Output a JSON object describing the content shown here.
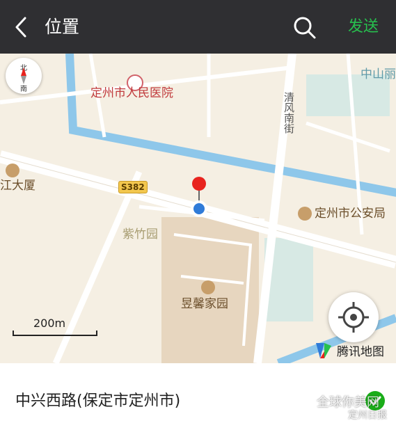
{
  "topbar": {
    "back_icon": "chevron-left-icon",
    "title": "位置",
    "search_icon": "search-icon",
    "send_label": "发送",
    "send_color": "#27c04e"
  },
  "map": {
    "compass": {
      "north": "北",
      "south": "南"
    },
    "labels": {
      "hospital": "定州市人民医院",
      "zhongshan": "中山丽",
      "qingfeng": "清风南街",
      "jiang_tower": "江大厦",
      "route_shield": "S382",
      "public_security": "定州市公安局",
      "zizhu_garden": "紫竹园",
      "yuxin_home": "昱馨家园"
    },
    "scale_label": "200m",
    "provider": "腾讯地图",
    "colors": {
      "water": "#8ec7ea",
      "land": "#f5efe3",
      "road": "#ffffff",
      "pin_red": "#e8231e",
      "pin_blue": "#2f7bd8",
      "poi_label": "#c0393b"
    }
  },
  "bottom": {
    "address": "中兴西路(保定市定州市)",
    "selected_icon": "check-icon"
  },
  "watermark": {
    "line1": "全球你美网",
    "line2": "定州日报"
  }
}
